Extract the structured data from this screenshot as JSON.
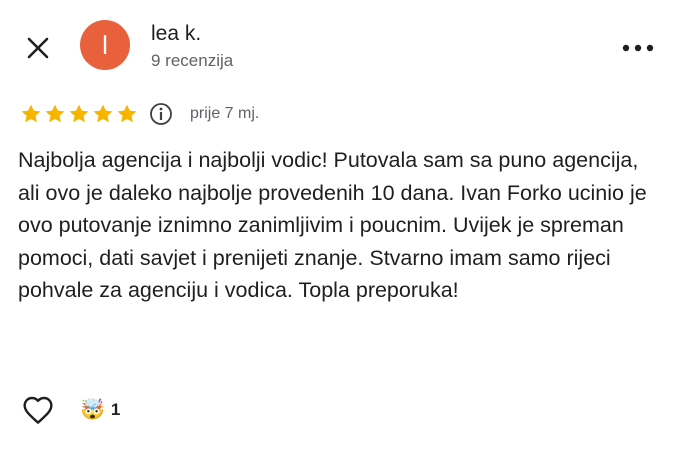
{
  "header": {
    "close_icon": "close-icon",
    "more_icon": "more-horizontal-icon"
  },
  "reviewer": {
    "avatar_initial": "l",
    "avatar_color": "#e8603c",
    "name": "lea k.",
    "review_count": "9 recenzija"
  },
  "review": {
    "rating": 5,
    "max_rating": 5,
    "star_color": "#f7b500",
    "info_icon": "info-icon",
    "date": "prije 7 mj.",
    "text": "Najbolja agencija i najbolji vodic! Putovala sam sa puno agencija, ali ovo je daleko najbolje provedenih 10 dana. Ivan Forko ucinio je ovo putovanje iznimno zanimljivim i poucnim. Uvijek je spreman pomoci, dati savjet i prenijeti znanje. Stvarno imam samo rijeci pohvale za agenciju i vodica. Topla preporuka!"
  },
  "actions": {
    "like_icon": "heart-icon",
    "reaction_emoji": "🤯",
    "reaction_count": "1"
  }
}
